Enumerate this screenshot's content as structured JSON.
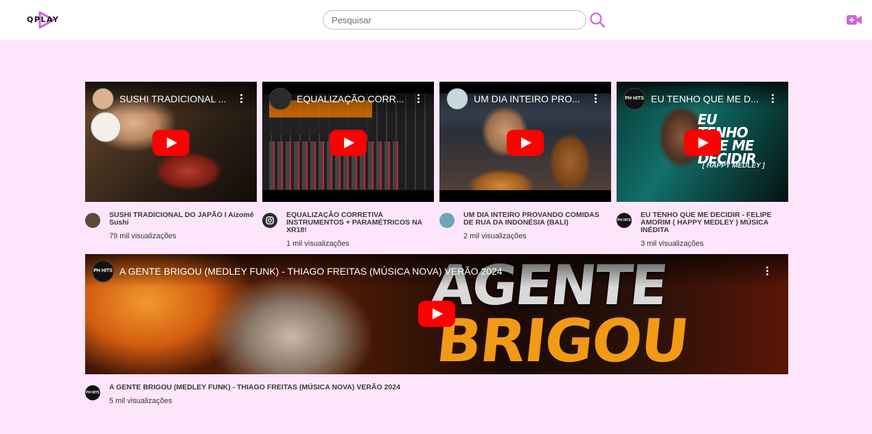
{
  "app": {
    "logo_text": "QPLAY"
  },
  "search": {
    "placeholder": "Pesquisar"
  },
  "videos": [
    {
      "thumb_title": "SUSHI TRADICIONAL ...",
      "title": "SUSHI TRADICIONAL DO JAPÃO I Aizomê Sushi",
      "views": "79 mil visualizações"
    },
    {
      "thumb_title": "EQUALIZAÇÃO CORR...",
      "title": "EQUALIZAÇÃO CORRETIVA INSTRUMENTOS + PARAMÉTRICOS NA XR18!",
      "views": "1 mil visualizações"
    },
    {
      "thumb_title": "UM DIA INTEIRO PRO...",
      "title": "UM DIA INTEIRO PROVANDO COMIDAS DE RUA DA INDONÉSIA (BALI)",
      "views": "2 mil visualizações"
    },
    {
      "thumb_title": "EU TENHO QUE ME D...",
      "title": "EU TENHO QUE ME DECIDIR - FELIPE AMORIM ( HAPPY MEDLEY ) MÚSICA INÉDITA",
      "views": "3 mil visualizações",
      "thumb_text": "EU TENHO QUE ME DECIDIR",
      "thumb_subtext": "[ HAPPY MEDLEY ]"
    },
    {
      "thumb_title": "A GENTE BRIGOU (MEDLEY FUNK) - THIAGO FREITAS (MÚSICA NOVA) VERÃO 2024",
      "title": "A GENTE BRIGOU (MEDLEY FUNK) - THIAGO FREITAS (MÚSICA NOVA) VERÃO 2024",
      "views": "5 mil visualizações",
      "thumb_text_1": "AGENTE",
      "thumb_text_2": "BRIGOU"
    }
  ],
  "channels": {
    "ph_hits": "PH HITS"
  },
  "colors": {
    "accent": "#c867d8",
    "page_bg": "#fde6fb",
    "play_red": "#ff0000"
  },
  "icons": {
    "search": "search-icon",
    "camera": "video-camera-add-icon",
    "play": "play-icon",
    "more": "more-vertical-icon"
  }
}
